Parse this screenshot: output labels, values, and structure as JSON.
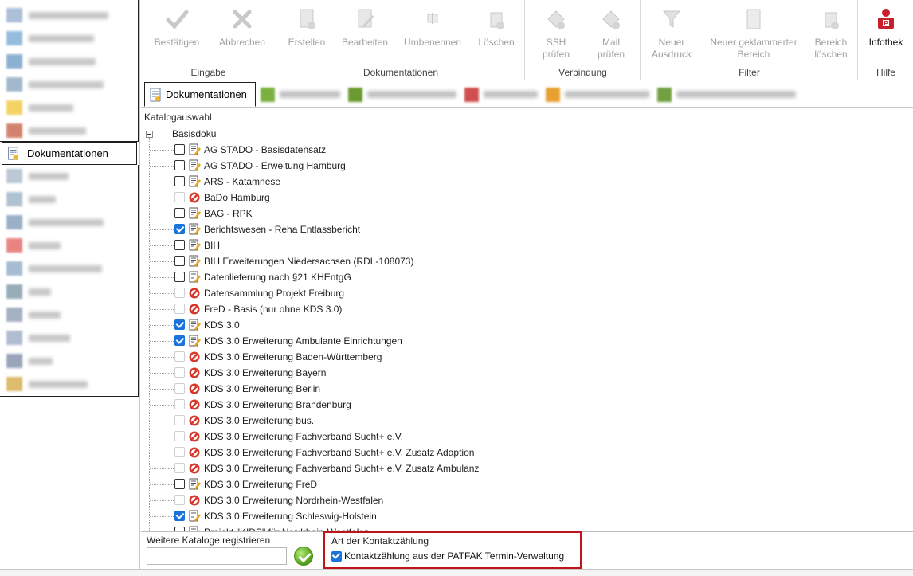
{
  "sidebar": {
    "items": [
      {
        "label": "",
        "blurred": true,
        "color": "#8aa4c8"
      },
      {
        "label": "",
        "blurred": true,
        "color": "#6aa0d0"
      },
      {
        "label": "",
        "blurred": true,
        "color": "#5b90c0"
      },
      {
        "label": "",
        "blurred": true,
        "color": "#7a9bb8"
      },
      {
        "label": "",
        "blurred": true,
        "color": "#f0c020"
      },
      {
        "label": "",
        "blurred": true,
        "color": "#c05030"
      },
      {
        "label": "Dokumentationen",
        "blurred": false,
        "active": true
      },
      {
        "label": "",
        "blurred": true,
        "color": "#a0b0c8"
      },
      {
        "label": "",
        "blurred": true,
        "color": "#90a8c0"
      },
      {
        "label": "",
        "blurred": true,
        "color": "#7090b0"
      },
      {
        "label": "",
        "blurred": true,
        "color": "#e05050"
      },
      {
        "label": "",
        "blurred": true,
        "color": "#80a0c0"
      },
      {
        "label": "",
        "blurred": true,
        "color": "#6a8a9a"
      },
      {
        "label": "",
        "blurred": true,
        "color": "#8090a8"
      },
      {
        "label": "",
        "blurred": true,
        "color": "#90a0c0"
      },
      {
        "label": "",
        "blurred": true,
        "color": "#7080a0"
      },
      {
        "label": "",
        "blurred": true,
        "color": "#d0a030"
      }
    ]
  },
  "ribbon": {
    "groups": [
      {
        "title": "Eingabe",
        "buttons": [
          {
            "label": "Bestätigen",
            "icon": "check-icon"
          },
          {
            "label": "Abbrechen",
            "icon": "cross-icon"
          }
        ]
      },
      {
        "title": "Dokumentationen",
        "buttons": [
          {
            "label": "Erstellen",
            "icon": "new-document-icon"
          },
          {
            "label": "Bearbeiten",
            "icon": "edit-document-icon"
          },
          {
            "label": "Umbenennen",
            "icon": "rename-icon"
          },
          {
            "label": "Löschen",
            "icon": "delete-icon"
          }
        ]
      },
      {
        "title": "Verbindung",
        "buttons": [
          {
            "label": "SSH",
            "label2": "prüfen",
            "icon": "ssh-check-icon"
          },
          {
            "label": "Mail",
            "label2": "prüfen",
            "icon": "mail-check-icon"
          }
        ]
      },
      {
        "title": "Filter",
        "buttons": [
          {
            "label": "Neuer",
            "label2": "Ausdruck",
            "icon": "filter-icon"
          },
          {
            "label": "Neuer geklammerter",
            "label2": "Bereich",
            "icon": "bracket-icon"
          },
          {
            "label": "Bereich",
            "label2": "löschen",
            "icon": "delete-range-icon"
          }
        ]
      },
      {
        "title": "Hilfe",
        "buttons": [
          {
            "label": "Infothek",
            "icon": "infothek-icon",
            "enabled": true
          }
        ]
      }
    ]
  },
  "tabs": [
    {
      "label": "Dokumentationen",
      "active": true
    },
    {
      "label": "",
      "blurred": true,
      "color": "#7ab040"
    },
    {
      "label": "",
      "blurred": true,
      "color": "#6a9a30"
    },
    {
      "label": "",
      "blurred": true,
      "color": "#d05050"
    },
    {
      "label": "",
      "blurred": true,
      "color": "#e8a030"
    },
    {
      "label": "",
      "blurred": true,
      "color": "#70a040"
    }
  ],
  "catalog": {
    "title": "Katalogauswahl",
    "root": "Basisdoku",
    "items": [
      {
        "label": "AG STADO - Basisdatensatz",
        "checked": false,
        "icon": "doc",
        "enabled": true
      },
      {
        "label": "AG STADO - Erweitung Hamburg",
        "checked": false,
        "icon": "doc",
        "enabled": true
      },
      {
        "label": "ARS - Katamnese",
        "checked": false,
        "icon": "doc",
        "enabled": true
      },
      {
        "label": "BaDo Hamburg",
        "checked": false,
        "icon": "blocked",
        "enabled": false
      },
      {
        "label": "BAG - RPK",
        "checked": false,
        "icon": "doc",
        "enabled": true
      },
      {
        "label": "Berichtswesen - Reha Entlassbericht",
        "checked": true,
        "icon": "doc",
        "enabled": true
      },
      {
        "label": "BIH",
        "checked": false,
        "icon": "doc",
        "enabled": true
      },
      {
        "label": "BIH Erweiterungen Niedersachsen (RDL-108073)",
        "checked": false,
        "icon": "doc",
        "enabled": true
      },
      {
        "label": "Datenlieferung nach §21 KHEntgG",
        "checked": false,
        "icon": "doc",
        "enabled": true
      },
      {
        "label": "Datensammlung Projekt Freiburg",
        "checked": false,
        "icon": "blocked",
        "enabled": false
      },
      {
        "label": "FreD - Basis (nur ohne KDS 3.0)",
        "checked": false,
        "icon": "blocked",
        "enabled": false
      },
      {
        "label": "KDS 3.0",
        "checked": true,
        "icon": "doc",
        "enabled": true
      },
      {
        "label": "KDS 3.0 Erweiterung Ambulante Einrichtungen",
        "checked": true,
        "icon": "doc",
        "enabled": true
      },
      {
        "label": "KDS 3.0 Erweiterung Baden-Württemberg",
        "checked": false,
        "icon": "blocked",
        "enabled": false
      },
      {
        "label": "KDS 3.0 Erweiterung Bayern",
        "checked": false,
        "icon": "blocked",
        "enabled": false
      },
      {
        "label": "KDS 3.0 Erweiterung Berlin",
        "checked": false,
        "icon": "blocked",
        "enabled": false
      },
      {
        "label": "KDS 3.0 Erweiterung Brandenburg",
        "checked": false,
        "icon": "blocked",
        "enabled": false
      },
      {
        "label": "KDS 3.0 Erweiterung bus.",
        "checked": false,
        "icon": "blocked",
        "enabled": false
      },
      {
        "label": "KDS 3.0 Erweiterung Fachverband Sucht+ e.V.",
        "checked": false,
        "icon": "blocked",
        "enabled": false
      },
      {
        "label": "KDS 3.0 Erweiterung Fachverband Sucht+ e.V. Zusatz Adaption",
        "checked": false,
        "icon": "blocked",
        "enabled": false
      },
      {
        "label": "KDS 3.0 Erweiterung Fachverband Sucht+ e.V. Zusatz Ambulanz",
        "checked": false,
        "icon": "blocked",
        "enabled": false
      },
      {
        "label": "KDS 3.0 Erweiterung FreD",
        "checked": false,
        "icon": "doc",
        "enabled": true
      },
      {
        "label": "KDS 3.0 Erweiterung Nordrhein-Westfalen",
        "checked": false,
        "icon": "blocked",
        "enabled": false
      },
      {
        "label": "KDS 3.0 Erweiterung Schleswig-Holstein",
        "checked": true,
        "icon": "doc",
        "enabled": true
      },
      {
        "label": "Projekt \"KIDS\" für Nordrhein-Westfalen",
        "checked": false,
        "icon": "doc",
        "enabled": true
      }
    ]
  },
  "bottom": {
    "further_label": "Weitere Kataloge registrieren",
    "further_value": "",
    "contact_title": "Art der Kontaktzählung",
    "contact_label": "Kontaktzählung aus der PATFAK Termin-Verwaltung",
    "contact_checked": true
  },
  "colors": {
    "highlight": "#c0141c",
    "checkbox_blue": "#1a73d9",
    "blocked_red": "#d33a2c"
  }
}
